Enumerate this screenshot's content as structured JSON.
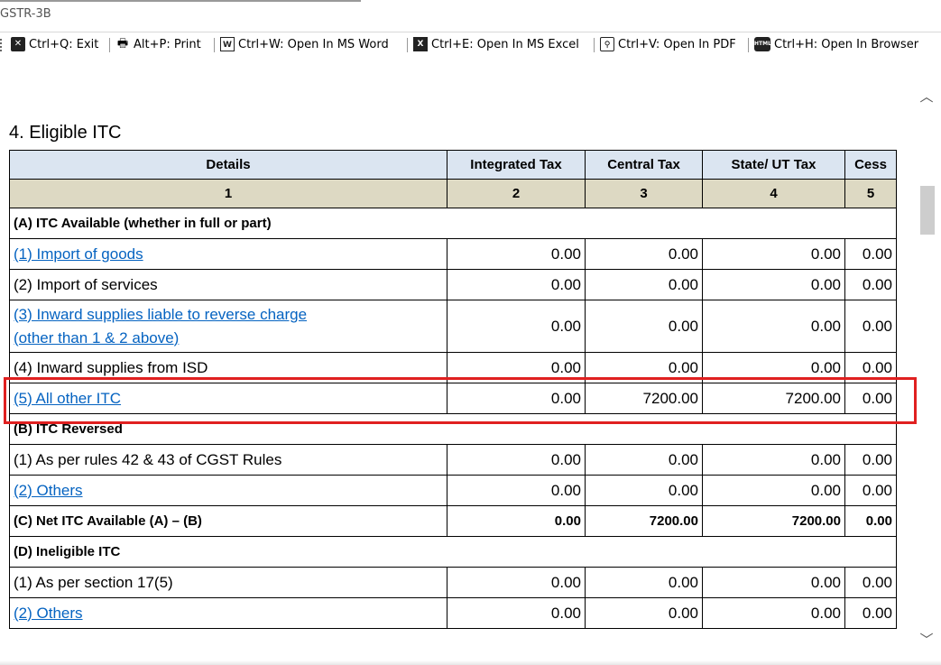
{
  "window": {
    "title": "GSTR-3B"
  },
  "toolbar": {
    "exit": "Ctrl+Q: Exit",
    "print": "Alt+P: Print",
    "word": "Ctrl+W: Open In MS Word",
    "excel": "Ctrl+E: Open In MS Excel",
    "pdf": "Ctrl+V: Open In PDF",
    "browser": "Ctrl+H: Open In Browser"
  },
  "section": {
    "heading": "4. Eligible ITC"
  },
  "table": {
    "headers": [
      "Details",
      "Integrated Tax",
      "Central Tax",
      "State/ UT Tax",
      "Cess"
    ],
    "col_numbers": [
      "1",
      "2",
      "3",
      "4",
      "5"
    ],
    "a_title": "(A) ITC Available (whether in full or part)",
    "a_rows": [
      {
        "label": "(1) Import of goods",
        "igst": "0.00",
        "cgst": "0.00",
        "sgst": "0.00",
        "cess": "0.00"
      },
      {
        "label": "(2) Import of services",
        "igst": "0.00",
        "cgst": "0.00",
        "sgst": "0.00",
        "cess": "0.00"
      },
      {
        "label1": "(3) Inward supplies liable to reverse charge",
        "label2": "(other than 1 & 2 above)",
        "igst": "0.00",
        "cgst": "0.00",
        "sgst": "0.00",
        "cess": "0.00"
      },
      {
        "label": "(4) Inward supplies from ISD",
        "igst": "0.00",
        "cgst": "0.00",
        "sgst": "0.00",
        "cess": "0.00"
      },
      {
        "label": "(5) All other ITC",
        "igst": "0.00",
        "cgst": "7200.00",
        "sgst": "7200.00",
        "cess": "0.00"
      }
    ],
    "b_title": "(B) ITC Reversed",
    "b_rows": [
      {
        "label": "(1) As per rules 42 & 43 of CGST Rules",
        "igst": "0.00",
        "cgst": "0.00",
        "sgst": "0.00",
        "cess": "0.00"
      },
      {
        "label": "(2) Others",
        "igst": "0.00",
        "cgst": "0.00",
        "sgst": "0.00",
        "cess": "0.00"
      }
    ],
    "c_row": {
      "label": "(C) Net ITC Available (A) – (B)",
      "igst": "0.00",
      "cgst": "7200.00",
      "sgst": "7200.00",
      "cess": "0.00"
    },
    "d_title": "(D) Ineligible ITC",
    "d_rows": [
      {
        "label": "(1) As per section 17(5)",
        "igst": "0.00",
        "cgst": "0.00",
        "sgst": "0.00",
        "cess": "0.00"
      },
      {
        "label": "(2) Others",
        "igst": "0.00",
        "cgst": "0.00",
        "sgst": "0.00",
        "cess": "0.00"
      }
    ]
  },
  "colors": {
    "highlight": "#e02020",
    "link": "#0563c1",
    "header_blue": "#dbe5f1",
    "header_tan": "#ddd9c3"
  }
}
